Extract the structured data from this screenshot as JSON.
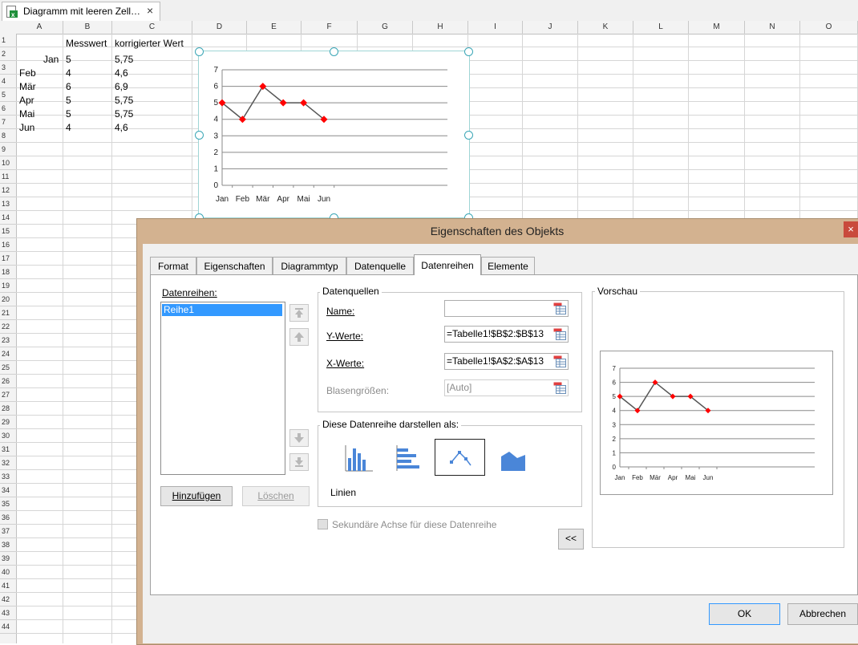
{
  "document_tab": {
    "title": "Diagramm mit leeren Zell…",
    "close": "×"
  },
  "columns": [
    "A",
    "B",
    "C",
    "D",
    "E",
    "F",
    "G",
    "H",
    "I",
    "J",
    "K",
    "L",
    "M",
    "N",
    "O"
  ],
  "rows": [
    "1",
    "2",
    "3",
    "4",
    "5",
    "6",
    "7",
    "8",
    "9",
    "10",
    "11",
    "12",
    "13",
    "14",
    "15",
    "16",
    "17",
    "18",
    "19",
    "20",
    "21",
    "22",
    "23",
    "24",
    "25",
    "26",
    "27",
    "28",
    "29",
    "30",
    "31",
    "32",
    "33",
    "34",
    "35",
    "36",
    "37",
    "38",
    "39",
    "40",
    "41",
    "42",
    "43",
    "44"
  ],
  "sheet": {
    "B1": "Messwert",
    "C1": "korrigierter Wert",
    "A2": "Jan",
    "B2": "5",
    "C2": "5,75",
    "A3": "Feb",
    "B3": "4",
    "C3": "4,6",
    "A4": "Mär",
    "B4": "6",
    "C4": "6,9",
    "A5": "Apr",
    "B5": "5",
    "C5": "5,75",
    "A6": "Mai",
    "B6": "5",
    "C6": "5,75",
    "A7": "Jun",
    "B7": "4",
    "C7": "4,6"
  },
  "chart_data": {
    "type": "line",
    "categories": [
      "Jan",
      "Feb",
      "Mär",
      "Apr",
      "Mai",
      "Jun"
    ],
    "series": [
      {
        "values": [
          5,
          4,
          6,
          5,
          5,
          4
        ]
      }
    ],
    "ylim": [
      0,
      7
    ],
    "yticks": [
      "0",
      "1",
      "2",
      "3",
      "4",
      "5",
      "6",
      "7"
    ],
    "xlabel": "",
    "ylabel": "",
    "title": "",
    "grid": true,
    "legend": false,
    "line_color": "#555555",
    "marker_color": "#ff0000"
  },
  "dialog": {
    "title": "Eigenschaften des Objekts",
    "close": "×",
    "tabs": [
      "Format",
      "Eigenschaften",
      "Diagrammtyp",
      "Datenquelle",
      "Datenreihen",
      "Elemente"
    ],
    "active_tab": "Datenreihen",
    "series_label": "Datenreihen:",
    "series_items": [
      "Reihe1"
    ],
    "add_button": "Hinzufügen",
    "delete_button": "Löschen",
    "data_sources_title": "Datenquellen",
    "name_label": "Name:",
    "name_value": "",
    "y_label": "Y-Werte:",
    "y_value": "=Tabelle1!$B$2:$B$13",
    "x_label": "X-Werte:",
    "x_value": "=Tabelle1!$A$2:$A$13",
    "bubble_label": "Blasengrößen:",
    "bubble_value": "[Auto]",
    "display_as_title": "Diese Datenreihe darstellen als:",
    "chart_types": [
      "column-chart-icon",
      "bar-chart-icon",
      "line-chart-icon",
      "area-chart-icon"
    ],
    "selected_type_label": "Linien",
    "secondary_axis_label": "Sekundäre Achse für diese Datenreihe",
    "collapse_button": "<<",
    "preview_title": "Vorschau",
    "ok_button": "OK",
    "cancel_button": "Abbrechen"
  },
  "colors": {
    "selection": "#3399ff",
    "dialog_border": "#d3b290",
    "close_button": "#c94a3c"
  }
}
